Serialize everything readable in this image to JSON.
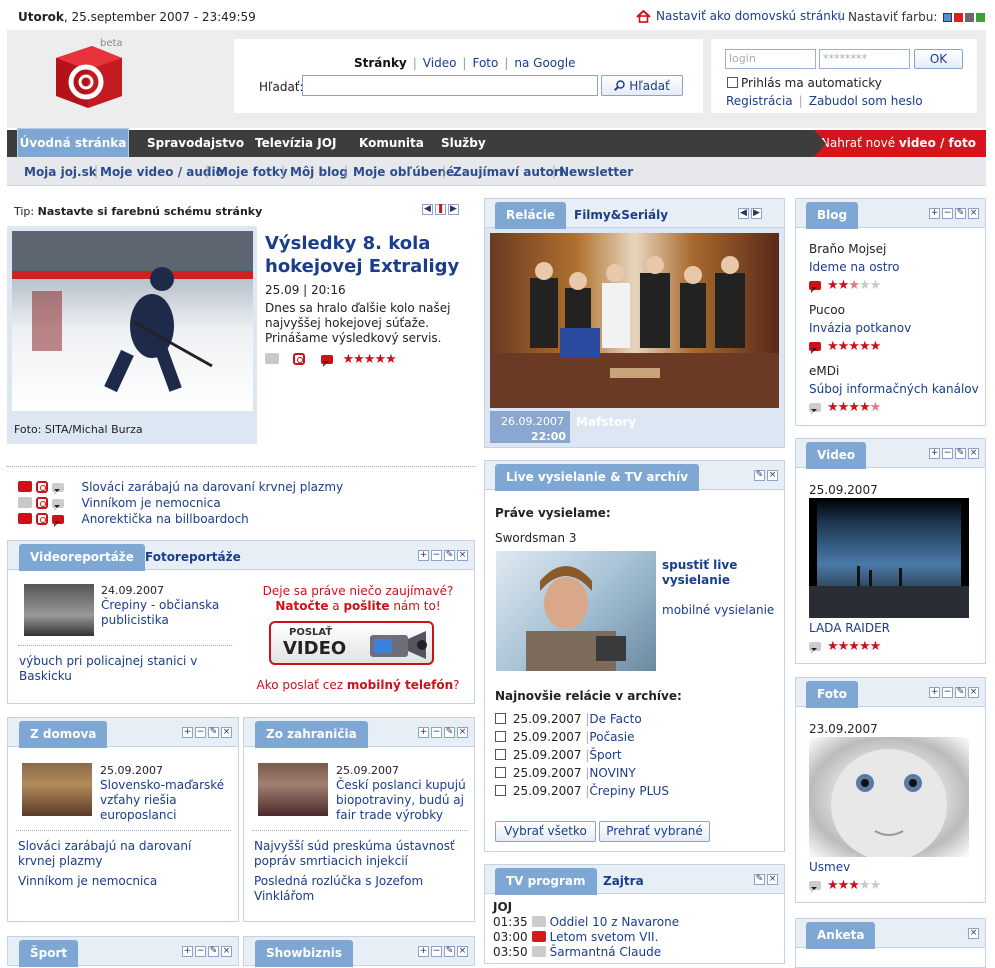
{
  "topbar": {
    "day": "Utorok",
    "datetime": ", 25.september 2007 - 23:49:59",
    "home_link": "Nastaviť ako domovskú stránku",
    "color_label": "Nastaviť farbu:",
    "color_swatches": [
      "#5b8bd0",
      "#e02020",
      "#6a6a6a",
      "#3da03d"
    ]
  },
  "logo": {
    "badge": "beta"
  },
  "search": {
    "tabs": [
      "Stránky",
      "Video",
      "Foto",
      "na Google"
    ],
    "label": "Hľadať:",
    "button": "Hľadať",
    "value": ""
  },
  "login": {
    "login_placeholder": "login",
    "password_placeholder": "********",
    "ok": "OK",
    "auto_label": "Prihlás ma automaticky",
    "register": "Registrácia",
    "forgot": "Zabudol som heslo"
  },
  "nav": {
    "items": [
      "Úvodná stránka",
      "Spravodajstvo",
      "Televízia JOJ",
      "Komunita",
      "Služby"
    ],
    "upload_prefix": "Nahrať nové ",
    "upload_bold": "video / foto"
  },
  "subnav": [
    "Moja joj.sk",
    "Moje video / audio",
    "Moje fotky",
    "Môj blog",
    "Moje obľúbené",
    "Zaujímaví autori",
    "Newsletter"
  ],
  "tip": {
    "prefix": "Tip:",
    "text": "Nastavte si farebnú schému stránky"
  },
  "headline": {
    "title": "Výsledky 8. kola hokejovej Extraligy",
    "date": "25.09 | 20:16",
    "text": "Dnes sa hralo ďalšie kolo našej najvyššej hokejovej súťaže. Prinášame výsledkový servis.",
    "caption": "Foto: SITA/Michal Burza",
    "rating": 5
  },
  "news_links": [
    "Slováci zarábajú na darovaní krvnej plazmy",
    "Vinníkom je nemocnica",
    "Anorektička na billboardoch"
  ],
  "reportaze": {
    "tabs": [
      "Videoreportáže",
      "Fotoreportáže"
    ],
    "item": {
      "date": "24.09.2007",
      "title": "Črepiny - občianska publicistika"
    },
    "link": "výbuch pri policajnej stanici v Baskicku",
    "promo_line1": "Deje sa práve niečo zaujímavé?",
    "promo_natocte": "Natočte",
    "promo_a": " a ",
    "promo_poslite": "pošlite",
    "promo_end": " nám to!",
    "btn_line1": "POSLAŤ",
    "btn_line2": "VIDEO",
    "promo_how": "Ako poslať cez ",
    "promo_mobile": "mobilný telefón",
    "promo_q": "?"
  },
  "zdomova": {
    "tab": "Z domova",
    "date": "25.09.2007",
    "title": "Slovensko-maďarské vzťahy riešia europoslanci",
    "links": [
      "Slováci zarábajú na darovaní krvnej plazmy",
      "Vinníkom je nemocnica"
    ]
  },
  "zozahranicia": {
    "tab": "Zo zahraničia",
    "date": "25.09.2007",
    "title": "Českí poslanci kupujú biopotraviny, budú aj fair trade výrobky",
    "links": [
      "Najvyšší súd preskúma ústavnosť popráv smrtiacich injekcií",
      "Posledná rozlúčka s Jozefom Vinklářom"
    ]
  },
  "bottom_tabs": [
    "Šport",
    "Showbiznis"
  ],
  "relacie": {
    "tabs": [
      "Relácie",
      "Filmy&Seriály"
    ],
    "date": "26.09.2007",
    "time": "22:00",
    "show": "Mafstory"
  },
  "live": {
    "tab": "Live vysielanie & TV archív",
    "now_label": "Práve vysielame:",
    "now_show": "Swordsman 3",
    "start_link": "spustiť live vysielanie",
    "mobile_link": "mobilné vysielanie",
    "archive_label": "Najnovšie relácie v archíve:",
    "archive": [
      {
        "date": "25.09.2007",
        "name": "De Facto"
      },
      {
        "date": "25.09.2007",
        "name": "Počasie"
      },
      {
        "date": "25.09.2007",
        "name": "Šport"
      },
      {
        "date": "25.09.2007",
        "name": "NOVINY"
      },
      {
        "date": "25.09.2007",
        "name": "Črepiny PLUS"
      }
    ],
    "select_all": "Vybrať všetko",
    "play_selected": "Prehrať vybrané"
  },
  "tvprogram": {
    "tabs": [
      "TV program",
      "Zajtra"
    ],
    "channel": "JOJ",
    "items": [
      {
        "time": "01:35",
        "title": "Oddiel 10 z Navarone"
      },
      {
        "time": "03:00",
        "title": "Letom svetom VII."
      },
      {
        "time": "03:50",
        "title": "Šarmantná Claude"
      }
    ]
  },
  "blog": {
    "tab": "Blog",
    "items": [
      {
        "author": "Braňo Mojsej",
        "title": "Ideme na ostro",
        "rating": 2.5
      },
      {
        "author": "Pucoo",
        "title": "Invázia potkanov",
        "rating": 5
      },
      {
        "author": "eMDi",
        "title": "Súboj informačných kanálov",
        "rating": 4.5
      }
    ]
  },
  "video": {
    "tab": "Video",
    "date": "25.09.2007",
    "title": "LADA RAIDER",
    "rating": 5
  },
  "foto": {
    "tab": "Foto",
    "date": "23.09.2007",
    "title": "Usmev",
    "rating": 3
  },
  "anketa": {
    "tab": "Anketa"
  }
}
